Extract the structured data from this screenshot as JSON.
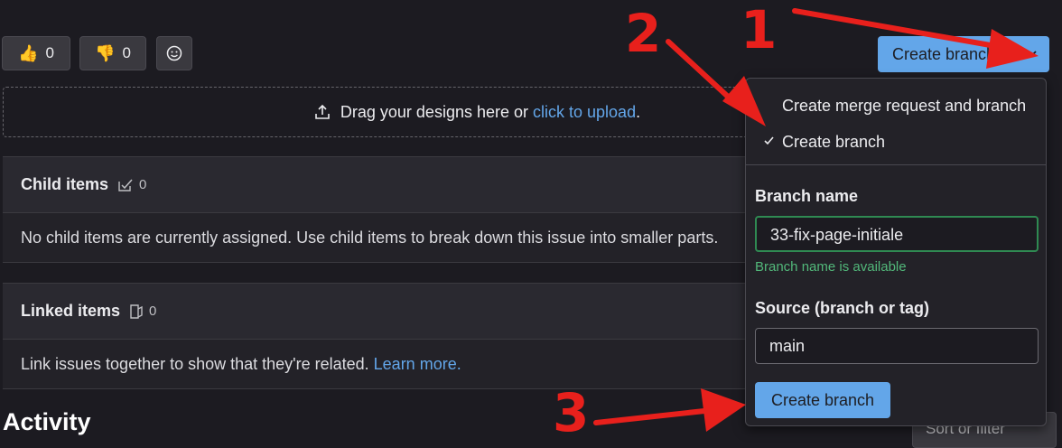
{
  "reactions": {
    "thumbs_up": {
      "icon": "thumbs-up-icon",
      "count": "0"
    },
    "thumbs_down": {
      "icon": "thumbs-down-icon",
      "count": "0"
    },
    "emoji": {
      "icon": "smile-icon"
    }
  },
  "upload": {
    "text": "Drag your designs here or",
    "link": "click to upload",
    "suffix": "."
  },
  "child_items": {
    "title": "Child items",
    "count": "0",
    "empty_text": "No child items are currently assigned. Use child items to break down this issue into smaller parts."
  },
  "linked_items": {
    "title": "Linked items",
    "count": "0",
    "empty_text": "Link issues together to show that they're related.",
    "link": "Learn more."
  },
  "activity": {
    "title": "Activity",
    "sort_label": "Sort or filter"
  },
  "create_branch_button": {
    "label": "Create branch"
  },
  "dropdown": {
    "option_merge_request": "Create merge request and branch",
    "option_branch": "Create branch",
    "branch_name_label": "Branch name",
    "branch_name_value": "33-fix-page-initiale",
    "branch_status": "Branch name is available",
    "source_label": "Source (branch or tag)",
    "source_value": "main",
    "submit_label": "Create branch"
  },
  "annotations": {
    "step1": "1",
    "step2": "2",
    "step3": "3",
    "color": "#e8201c"
  },
  "colors": {
    "background": "#1c1b21",
    "primary_button": "#63a6e9",
    "link": "#63a6e9",
    "success": "#52b87a"
  }
}
